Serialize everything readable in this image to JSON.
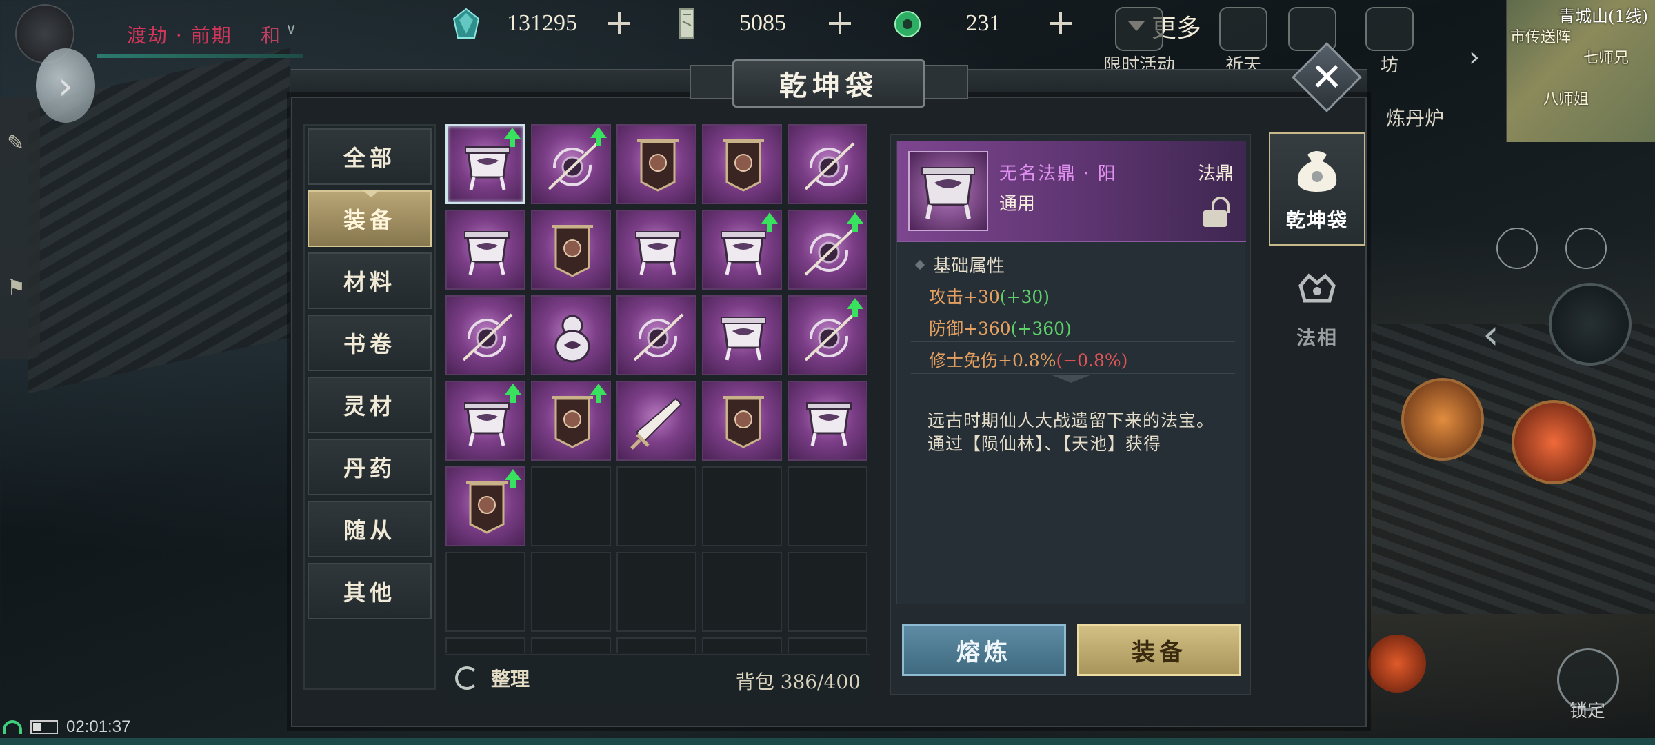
{
  "player": {
    "realm": "渡劫 · 前期",
    "realm_suffix": "和"
  },
  "currencies": [
    {
      "icon": "spirit-stone-icon",
      "value": "131295"
    },
    {
      "icon": "talisman-icon",
      "value": "5085"
    },
    {
      "icon": "jade-icon",
      "value": "231"
    }
  ],
  "more_label": "更多",
  "quick_icons": [
    "限时活动",
    "祈天",
    "",
    "坊"
  ],
  "minimap": {
    "title": "青城山(1线)",
    "labels": [
      "市传送阵",
      "七师兄",
      "八师姐"
    ]
  },
  "right_hud": {
    "furnace_label": "炼丹炉",
    "lock_label": "锁定"
  },
  "status_bar": {
    "time": "02:01:37"
  },
  "panel": {
    "title": "乾坤袋",
    "close_label": "✕",
    "categories": [
      {
        "label": "全部",
        "active": false
      },
      {
        "label": "装备",
        "active": true
      },
      {
        "label": "材料",
        "active": false
      },
      {
        "label": "书卷",
        "active": false
      },
      {
        "label": "灵材",
        "active": false
      },
      {
        "label": "丹药",
        "active": false
      },
      {
        "label": "随从",
        "active": false
      },
      {
        "label": "其他",
        "active": false
      }
    ],
    "items": [
      {
        "kind": "cauldron",
        "upgrade": true,
        "selected": true
      },
      {
        "kind": "blade-swirl",
        "upgrade": true
      },
      {
        "kind": "banner",
        "upgrade": false
      },
      {
        "kind": "banner",
        "upgrade": false
      },
      {
        "kind": "blade-swirl",
        "upgrade": false
      },
      {
        "kind": "cauldron",
        "upgrade": false
      },
      {
        "kind": "banner",
        "upgrade": false
      },
      {
        "kind": "cauldron",
        "upgrade": false
      },
      {
        "kind": "cauldron",
        "upgrade": true
      },
      {
        "kind": "blade-swirl",
        "upgrade": true
      },
      {
        "kind": "blade-swirl",
        "upgrade": false
      },
      {
        "kind": "gourd",
        "upgrade": false
      },
      {
        "kind": "blade-swirl",
        "upgrade": false
      },
      {
        "kind": "cauldron",
        "upgrade": false
      },
      {
        "kind": "blade-swirl",
        "upgrade": true
      },
      {
        "kind": "cauldron",
        "upgrade": true
      },
      {
        "kind": "banner",
        "upgrade": true
      },
      {
        "kind": "sword",
        "upgrade": false
      },
      {
        "kind": "banner",
        "upgrade": false
      },
      {
        "kind": "cauldron",
        "upgrade": false
      },
      {
        "kind": "banner",
        "upgrade": true
      }
    ],
    "sort_label": "整理",
    "bag_label": "背包 386/400"
  },
  "detail": {
    "name": "无名法鼎 · 阳",
    "type": "法鼎",
    "usage": "通用",
    "section": "基础属性",
    "stats": [
      {
        "label": "攻击+30",
        "delta": "(+30)",
        "sign": "pos"
      },
      {
        "label": "防御+360",
        "delta": "(+360)",
        "sign": "pos"
      },
      {
        "label": "修士免伤+0.8%",
        "delta": "(−0.8%)",
        "sign": "neg"
      }
    ],
    "description": "远古时期仙人大战遗留下来的法宝。通过【陨仙林】、【天池】获得",
    "smelt_label": "熔炼",
    "equip_label": "装备"
  },
  "side_tabs": [
    {
      "label": "乾坤袋",
      "icon": "pouch-icon",
      "active": true
    },
    {
      "label": "法相",
      "icon": "avatar-crown-icon",
      "active": false
    }
  ],
  "colors": {
    "epic_purple": "#7b3e87",
    "upgrade_green": "#39e25e",
    "stat_orange": "#e3a060",
    "accent_gold": "#c9b98a"
  }
}
